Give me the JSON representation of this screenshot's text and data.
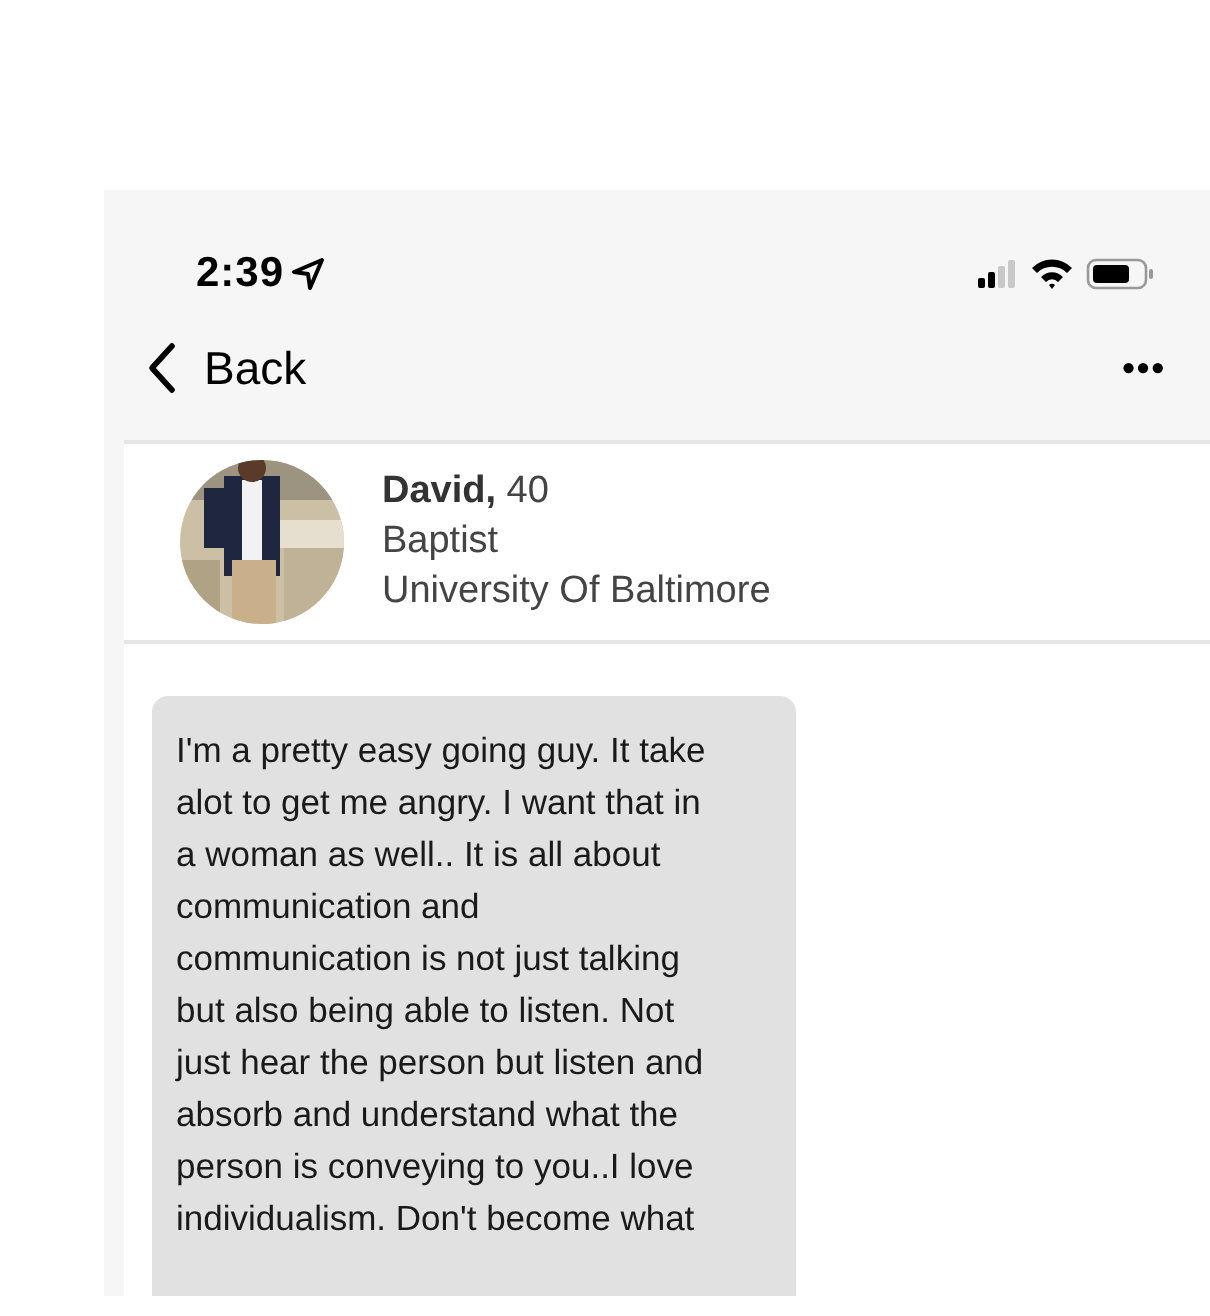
{
  "status_bar": {
    "time": "2:39"
  },
  "nav": {
    "back": "Back",
    "more": "•••"
  },
  "profile": {
    "name": "David,",
    "age": "40",
    "religion": "Baptist",
    "school": "University Of Baltimore"
  },
  "message": {
    "text": "I'm a pretty easy going guy. It take\nalot to get me angry. I want that in\na woman as well.. It is all about\ncommunication and\ncommunication is not just talking\nbut also being able to listen. Not\njust hear the person but listen and\nabsorb and understand what the\nperson is conveying to you..I love\nindividualism. Don't become what"
  }
}
